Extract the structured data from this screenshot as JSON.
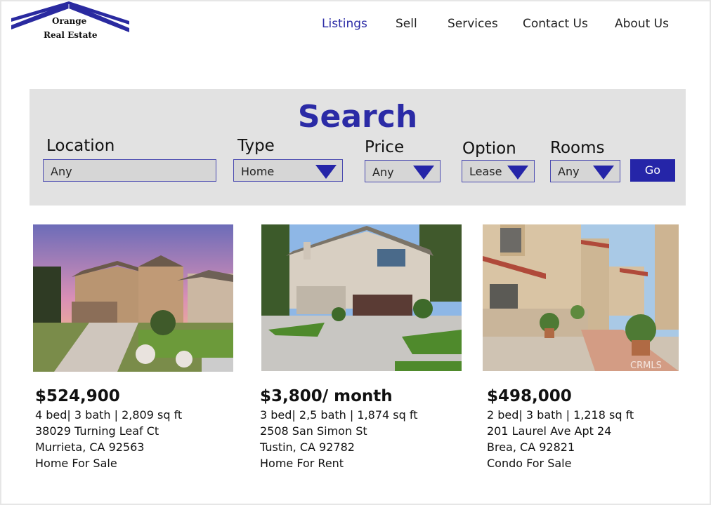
{
  "brand": {
    "line1": "Orange",
    "line2": "Real Estate"
  },
  "nav": [
    {
      "label": "Listings"
    },
    {
      "label": "Sell"
    },
    {
      "label": "Services"
    },
    {
      "label": "Contact Us"
    },
    {
      "label": "About Us"
    }
  ],
  "search": {
    "title": "Search",
    "fields": [
      {
        "label": "Location",
        "value": "Any"
      },
      {
        "label": "Type",
        "value": "Home"
      },
      {
        "label": "Price",
        "value": "Any"
      },
      {
        "label": "Option",
        "value": "Lease"
      },
      {
        "label": "Rooms",
        "value": "Any"
      }
    ],
    "go_label": "Go"
  },
  "listings": [
    {
      "price": "$524,900",
      "details": "4 bed| 3 bath | 2,809 sq ft",
      "address": "38029 Turning Leaf Ct",
      "city": "Murrieta, CA 92563",
      "status": "Home For Sale"
    },
    {
      "price": "$3,800/ month",
      "details": "3 bed| 2,5 bath | 1,874 sq ft",
      "address": "2508 San Simon St",
      "city": "Tustin, CA 92782",
      "status": "Home For Rent"
    },
    {
      "price": "$498,000",
      "details": "2 bed| 3 bath | 1,218 sq ft",
      "address": "201 Laurel Ave Apt 24",
      "city": "Brea, CA 92821",
      "status": "Condo For Sale"
    }
  ],
  "photo_watermark": "CRMLS",
  "colors": {
    "accent": "#2b2ba6",
    "panel": "#e2e2e2",
    "button": "#2525a8"
  }
}
